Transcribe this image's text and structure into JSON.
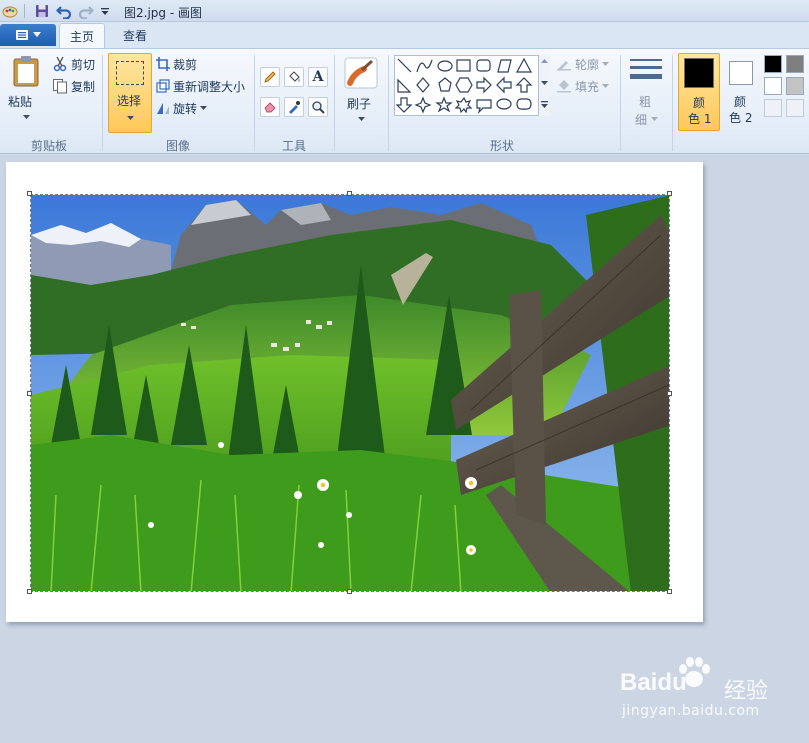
{
  "window": {
    "title": "图2.jpg - 画图"
  },
  "tabs": [
    {
      "label": "主页"
    },
    {
      "label": "查看"
    }
  ],
  "clipboard": {
    "paste_label": "粘贴",
    "cut_label": "剪切",
    "copy_label": "复制",
    "group_label": "剪贴板"
  },
  "image_group": {
    "select_label": "选择",
    "crop_label": "裁剪",
    "resize_label": "重新调整大小",
    "rotate_label": "旋转",
    "group_label": "图像"
  },
  "tools_group": {
    "group_label": "工具",
    "icons": [
      "pencil-icon",
      "fill-icon",
      "text-icon",
      "eraser-icon",
      "color-picker-icon",
      "magnifier-icon"
    ]
  },
  "brushes": {
    "label": "刷子"
  },
  "shapes_group": {
    "outline_label": "轮廓",
    "fill_label": "填充",
    "group_label": "形状"
  },
  "size": {
    "label_1": "粗",
    "label_2": "细"
  },
  "colors": {
    "color1_line1": "颜",
    "color1_line2": "色 1",
    "color2_line1": "颜",
    "color2_line2": "色 2",
    "color1_value": "#000000",
    "color2_value": "#ffffff",
    "palette": [
      "#000000",
      "#7f7f7f",
      "#ffffff",
      "#c3c3c3"
    ]
  },
  "watermark": {
    "brand": "Baidu",
    "brand_cn": "经验",
    "url": "jingyan.baidu.com"
  }
}
